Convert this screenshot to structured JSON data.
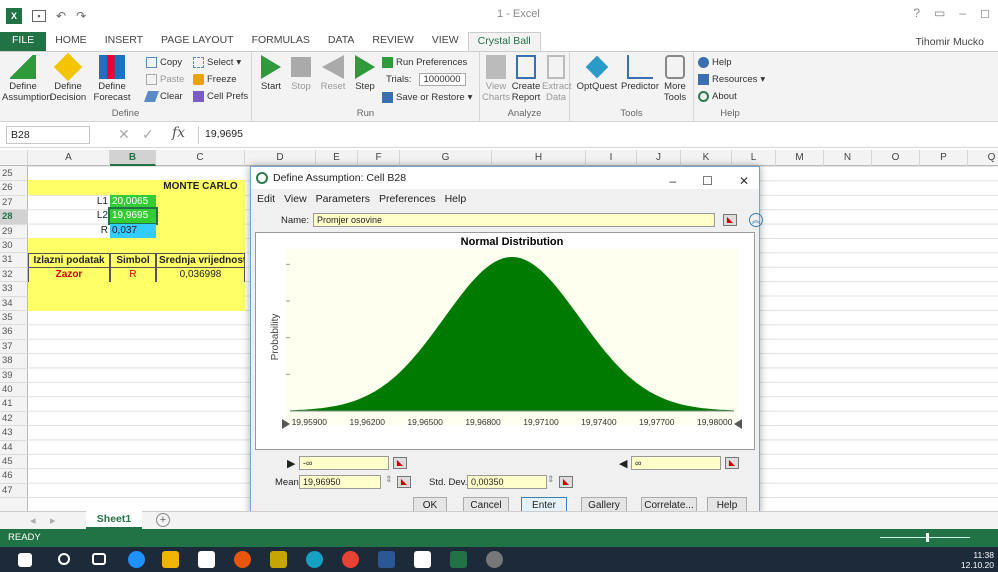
{
  "window": {
    "title": "1 - Excel",
    "user": "Tihomir Mucko"
  },
  "qat": {
    "undo": "↶",
    "redo": "↷"
  },
  "tabs": [
    "FILE",
    "HOME",
    "INSERT",
    "PAGE LAYOUT",
    "FORMULAS",
    "DATA",
    "REVIEW",
    "VIEW",
    "Crystal Ball"
  ],
  "ribbon": {
    "define": {
      "label": "Define",
      "define_assumption": "Define Assumption",
      "define_decision": "Define Decision",
      "define_forecast": "Define Forecast",
      "copy": "Copy",
      "paste": "Paste",
      "clear": "Clear",
      "select": "Select",
      "freeze": "Freeze",
      "cell_prefs": "Cell Prefs"
    },
    "run": {
      "label": "Run",
      "start": "Start",
      "stop": "Stop",
      "reset": "Reset",
      "step": "Step",
      "run_prefs": "Run Preferences",
      "trials_label": "Trials:",
      "trials_value": "1000000",
      "save_restore": "Save or Restore"
    },
    "analyze": {
      "label": "Analyze",
      "view_charts": "View Charts",
      "create_report": "Create Report",
      "extract_data": "Extract Data"
    },
    "tools": {
      "label": "Tools",
      "optquest": "OptQuest",
      "predictor": "Predictor",
      "more_tools": "More Tools"
    },
    "help": {
      "label": "Help",
      "help": "Help",
      "resources": "Resources",
      "about": "About"
    }
  },
  "formula_bar": {
    "name_box": "B28",
    "formula": "19,9695",
    "fx": "fx"
  },
  "columns": [
    "A",
    "B",
    "C",
    "D",
    "E",
    "F",
    "G",
    "H",
    "I",
    "J",
    "K",
    "L",
    "M",
    "N",
    "O",
    "P",
    "Q"
  ],
  "rows": [
    "25",
    "26",
    "27",
    "28",
    "29",
    "30",
    "31",
    "32",
    "33",
    "34",
    "35",
    "36",
    "37",
    "38",
    "39",
    "40",
    "41",
    "42",
    "43",
    "44",
    "45",
    "46",
    "47"
  ],
  "sheet": {
    "monte_carlo": "MONTE CARLO",
    "l1_label": "L1",
    "l1_value": "20,0065",
    "l2_label": "L2",
    "l2_value": "19,9695",
    "r_label": "R",
    "r_value": "0,037",
    "hdr_output": "Izlazni podatak",
    "hdr_symbol": "Simbol",
    "hdr_mean": "Srednja vrijednost",
    "row_output": "Zazor",
    "row_symbol": "R",
    "row_mean": "0,036998"
  },
  "dialog": {
    "title": "Define Assumption: Cell B28",
    "menu": [
      "Edit",
      "View",
      "Parameters",
      "Preferences",
      "Help"
    ],
    "name_label": "Name:",
    "name_value": "Promjer osovine",
    "chart_title": "Normal Distribution",
    "ylabel": "Probability",
    "min_value": "-∞",
    "max_value": "∞",
    "mean_label": "Mean",
    "mean_value": "19,96950",
    "std_label": "Std. Dev.",
    "std_value": "0,00350",
    "buttons": [
      "OK",
      "Cancel",
      "Enter",
      "Gallery",
      "Correlate...",
      "Help"
    ]
  },
  "chart_data": {
    "type": "area",
    "title": "Normal Distribution",
    "ylabel": "Probability",
    "xlabel": "",
    "mean": 19.9695,
    "std_dev": 0.0035,
    "xlim": [
      19.958,
      19.981
    ],
    "x_ticks": [
      "19,95900",
      "19,96200",
      "19,96500",
      "19,96800",
      "19,97100",
      "19,97400",
      "19,97700",
      "19,98000"
    ],
    "fill_color": "#007a00"
  },
  "sheet_tab": "Sheet1",
  "status": "READY",
  "clock": {
    "time": "11:38",
    "date": "12.10.20"
  }
}
